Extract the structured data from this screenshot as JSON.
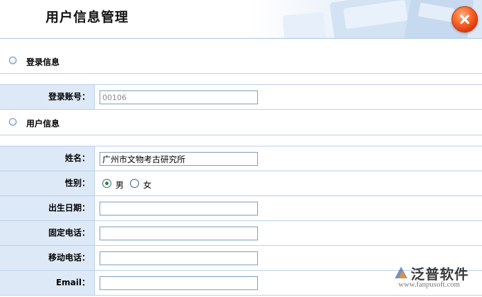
{
  "window": {
    "title": "用户信息管理",
    "close_icon": "close-icon"
  },
  "sections": {
    "login": {
      "title": "登录信息",
      "account_label": "登录账号：",
      "account_value": "00106"
    },
    "user": {
      "title": "用户信息",
      "name_label": "姓名：",
      "name_value": "广州市文物考古研究所",
      "gender_label": "性别：",
      "gender_options": [
        "男",
        "女"
      ],
      "gender_selected": "男",
      "birth_label": "出生日期：",
      "birth_value": "",
      "phone_label": "固定电话：",
      "phone_value": "",
      "mobile_label": "移动电话：",
      "mobile_value": "",
      "email_label": "Email：",
      "email_value": ""
    }
  },
  "watermark": {
    "name": "泛普软件",
    "url": "www.fanpusoft.com"
  },
  "colors": {
    "label_bg": "#dde9f7",
    "border": "#b9d0ea",
    "close_button": "#ff6a2c"
  }
}
